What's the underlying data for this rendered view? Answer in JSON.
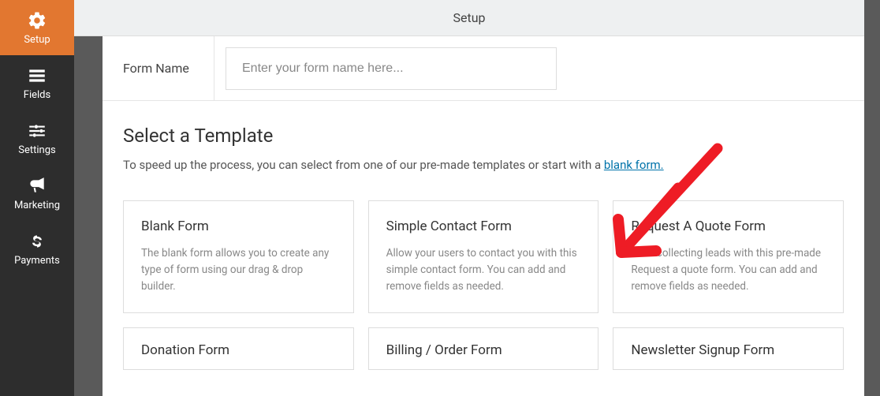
{
  "header": {
    "title": "Setup"
  },
  "sidebar": {
    "items": [
      {
        "label": "Setup"
      },
      {
        "label": "Fields"
      },
      {
        "label": "Settings"
      },
      {
        "label": "Marketing"
      },
      {
        "label": "Payments"
      }
    ]
  },
  "form_name": {
    "label": "Form Name",
    "placeholder": "Enter your form name here..."
  },
  "template_section": {
    "title": "Select a Template",
    "desc_prefix": "To speed up the process, you can select from one of our pre-made templates or start with a ",
    "link_text": "blank form."
  },
  "templates": [
    {
      "title": "Blank Form",
      "desc": "The blank form allows you to create any type of form using our drag & drop builder."
    },
    {
      "title": "Simple Contact Form",
      "desc": "Allow your users to contact you with this simple contact form. You can add and remove fields as needed."
    },
    {
      "title": "Request A Quote Form",
      "desc": "Start collecting leads with this pre-made Request a quote form. You can add and remove fields as needed."
    },
    {
      "title": "Donation Form",
      "desc": ""
    },
    {
      "title": "Billing / Order Form",
      "desc": ""
    },
    {
      "title": "Newsletter Signup Form",
      "desc": ""
    }
  ]
}
